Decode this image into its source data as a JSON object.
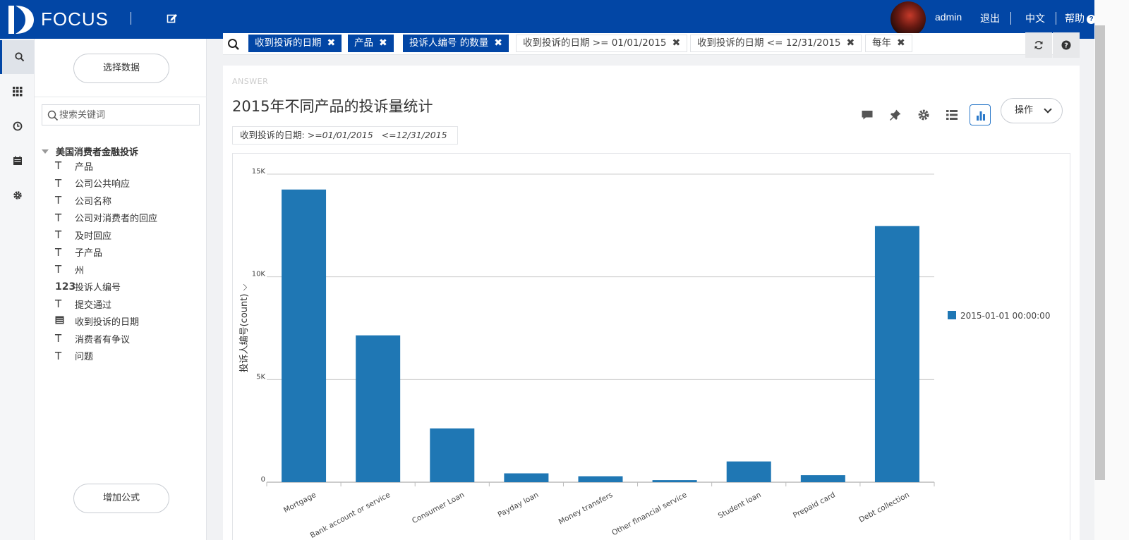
{
  "header": {
    "logo_text": "FOCUS",
    "user": "admin",
    "logout": "退出",
    "language": "中文",
    "help": "帮助"
  },
  "sidebar": {
    "select_data": "选择数据",
    "search_placeholder": "搜索关键词",
    "source_name": "美国消费者金融投诉",
    "fields": [
      {
        "icon": "text-type-icon",
        "label": "产品"
      },
      {
        "icon": "text-type-icon",
        "label": "公司公共响应"
      },
      {
        "icon": "text-type-icon",
        "label": "公司名称"
      },
      {
        "icon": "text-type-icon",
        "label": "公司对消费者的回应"
      },
      {
        "icon": "text-type-icon",
        "label": "及时回应"
      },
      {
        "icon": "text-type-icon",
        "label": "子产品"
      },
      {
        "icon": "text-type-icon",
        "label": "州"
      },
      {
        "icon": "number-type-icon",
        "label": "投诉人编号"
      },
      {
        "icon": "text-type-icon",
        "label": "提交通过"
      },
      {
        "icon": "date-type-icon",
        "label": "收到投诉的日期"
      },
      {
        "icon": "text-type-icon",
        "label": "消费者有争议"
      },
      {
        "icon": "text-type-icon",
        "label": "问题"
      }
    ],
    "add_formula": "增加公式"
  },
  "search_bar": {
    "tokens": [
      {
        "label": "收到投诉的日期",
        "style": "dark"
      },
      {
        "label": "产品",
        "style": "dark"
      },
      {
        "label": "投诉人编号 的数量",
        "style": "dark"
      },
      {
        "label": "收到投诉的日期 >= 01/01/2015",
        "style": "light"
      },
      {
        "label": "收到投诉的日期 <= 12/31/2015",
        "style": "light"
      },
      {
        "label": "每年",
        "style": "light"
      }
    ]
  },
  "answer": {
    "label": "ANSWER",
    "title": "2015年不同产品的投诉量统计",
    "filter_label": "收到投诉的日期:",
    "filter_value": ">=01/01/2015   <=12/31/2015",
    "ops_button": "操作"
  },
  "chart_data": {
    "type": "bar",
    "ylabel": "投诉人编号(count)",
    "ylim": [
      0,
      15000
    ],
    "yticks": [
      0,
      5000,
      10000,
      15000
    ],
    "ytick_labels": [
      "0",
      "5K",
      "10K",
      "15K"
    ],
    "categories": [
      "Mortgage",
      "Bank account or service",
      "Consumer Loan",
      "Payday loan",
      "Money transfers",
      "Other financial service",
      "Student loan",
      "Prepaid card",
      "Debt collection"
    ],
    "series": [
      {
        "name": "2015-01-01 00:00:00",
        "values": [
          14250,
          7150,
          2620,
          430,
          290,
          100,
          1010,
          340,
          12470
        ]
      }
    ],
    "legend_position": "right",
    "grid": true,
    "color": "#1f77b4"
  }
}
